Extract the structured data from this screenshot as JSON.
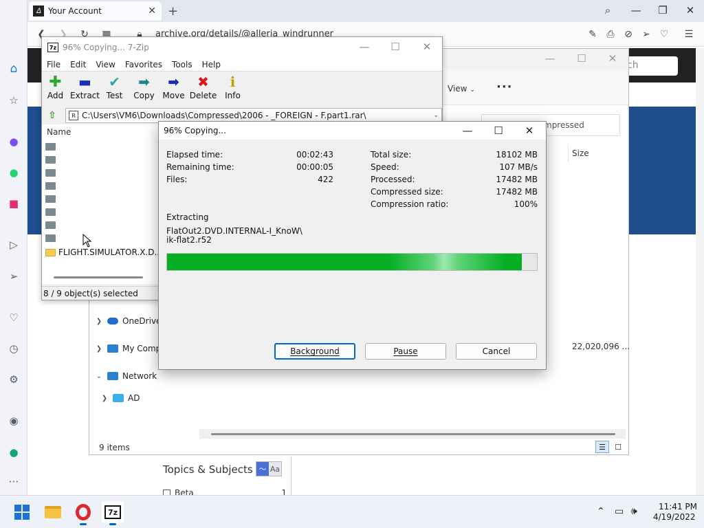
{
  "browser": {
    "tab_title": "Your Account",
    "favicon": "archive-icon",
    "new_tab": "+",
    "url": "archive.org/details/@alleria_windrunner",
    "search_partial": "ch",
    "sidebar_icons": [
      "home-icon",
      "bookmark-icon",
      "messenger-icon",
      "whatsapp-icon",
      "instagram-icon",
      "player-icon",
      "send-icon",
      "heart-icon",
      "history-icon",
      "settings-icon",
      "lightbulb-icon",
      "account-icon",
      "more-icon"
    ]
  },
  "webpage": {
    "topics_title": "Topics & Subjects",
    "topics_toggle_a": "Aa",
    "beta_label": "Beta",
    "beta_count": "1"
  },
  "explorer": {
    "view_label": "View",
    "search_placeholder": "mpressed",
    "size_header": "Size",
    "size_value": "22,020,096 ...",
    "nav": [
      {
        "label": "OneDrive",
        "expanded": false
      },
      {
        "label": "My Comp",
        "expanded": false
      },
      {
        "label": "Network",
        "expanded": true
      },
      {
        "label": "AD",
        "expanded": false
      }
    ],
    "status": "9 items"
  },
  "sevenzip": {
    "title": "96% Copying... 7-Zip",
    "menu": [
      "File",
      "Edit",
      "View",
      "Favorites",
      "Tools",
      "Help"
    ],
    "toolbar": [
      {
        "label": "Add",
        "icon": "plus-icon",
        "color": "#2ea82e",
        "glyph": "✚"
      },
      {
        "label": "Extract",
        "icon": "minus-icon",
        "color": "#1b2bb4",
        "glyph": "▬"
      },
      {
        "label": "Test",
        "icon": "check-icon",
        "color": "#2aa6a6",
        "glyph": "✔"
      },
      {
        "label": "Copy",
        "icon": "copy-arrow-icon",
        "color": "#1c8a84",
        "glyph": "➡"
      },
      {
        "label": "Move",
        "icon": "move-arrow-icon",
        "color": "#1b2bb4",
        "glyph": "➡"
      },
      {
        "label": "Delete",
        "icon": "delete-x-icon",
        "color": "#d41c1c",
        "glyph": "✖"
      },
      {
        "label": "Info",
        "icon": "info-icon",
        "color": "#b8a400",
        "glyph": "ℹ"
      }
    ],
    "path": "C:\\Users\\VM6\\Downloads\\Compressed\\2006 - _FOREIGN - F.part1.rar\\",
    "name_header": "Name",
    "last_item": "FLIGHT.SIMULATOR.X.D...",
    "status": "8 / 9 object(s) selected"
  },
  "dialog": {
    "title": "96% Copying...",
    "elapsed_label": "Elapsed time:",
    "elapsed_value": "00:02:43",
    "remaining_label": "Remaining time:",
    "remaining_value": "00:00:05",
    "files_label": "Files:",
    "files_value": "422",
    "total_size_label": "Total size:",
    "total_size_value": "18102 MB",
    "speed_label": "Speed:",
    "speed_value": "107 MB/s",
    "processed_label": "Processed:",
    "processed_value": "17482 MB",
    "compressed_size_label": "Compressed size:",
    "compressed_size_value": "17482 MB",
    "ratio_label": "Compression ratio:",
    "ratio_value": "100%",
    "extracting_label": "Extracting",
    "current_file_line1": "FlatOut2.DVD.INTERNAL-I_KnoW\\",
    "current_file_line2": "ik-flat2.r52",
    "progress_fraction": 0.96,
    "progress_color": "#06b025",
    "background_button": "Background",
    "pause_button": "Pause",
    "cancel_button": "Cancel"
  },
  "taskbar": {
    "time": "11:41 PM",
    "date": "4/19/2022"
  }
}
